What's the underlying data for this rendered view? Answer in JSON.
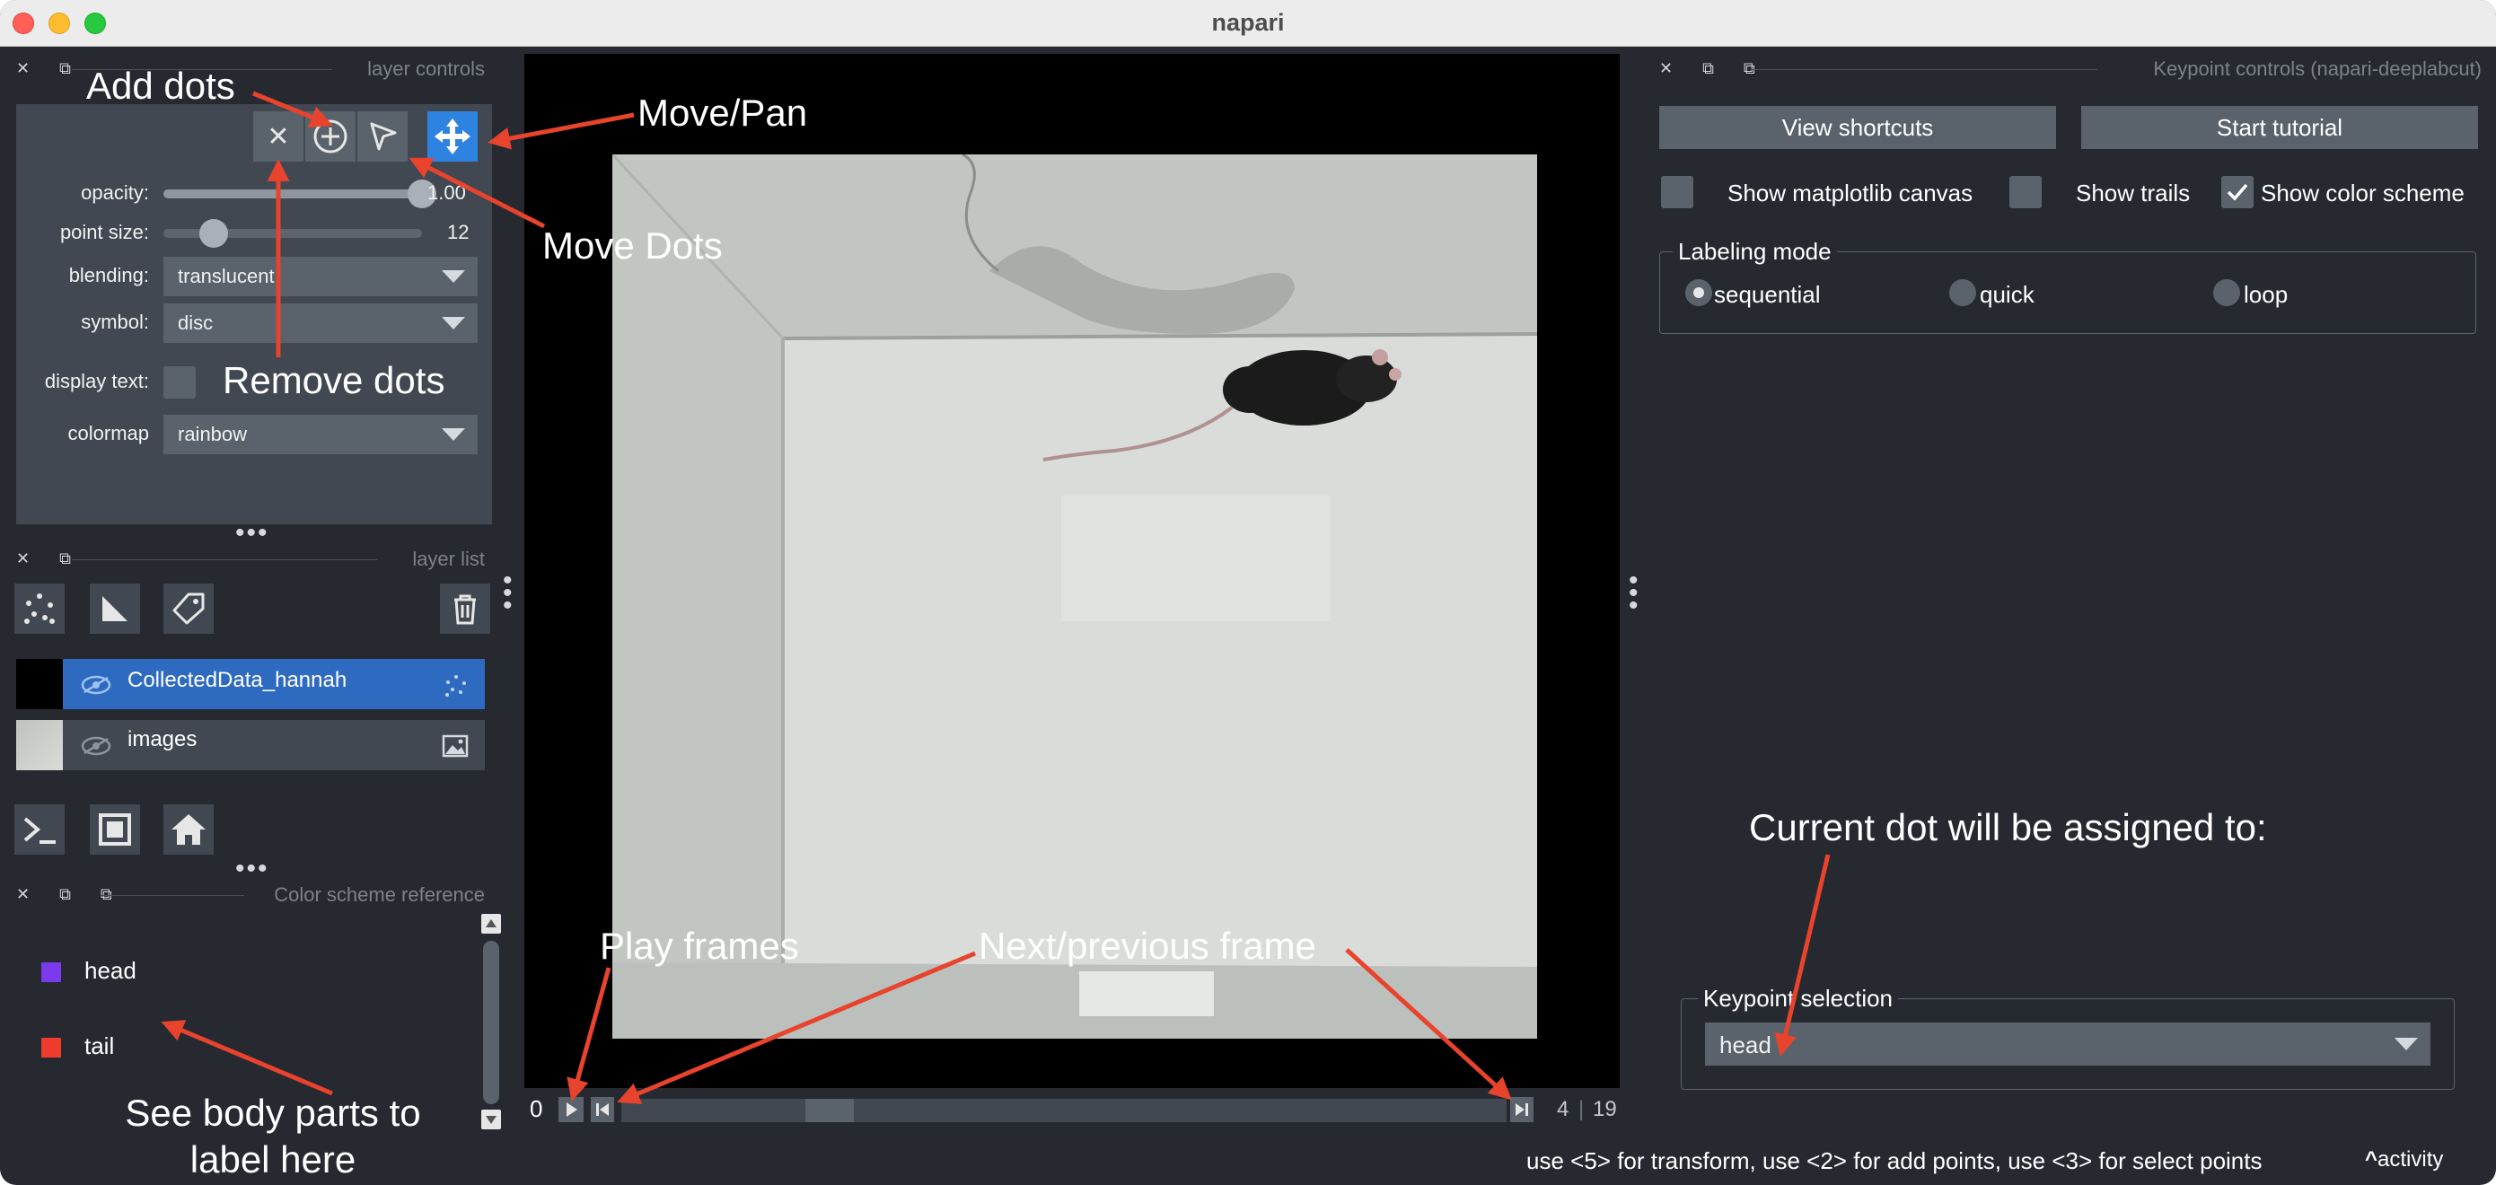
{
  "window": {
    "title": "napari"
  },
  "layer_controls": {
    "panel_title": "layer controls",
    "properties": {
      "opacity_label": "opacity:",
      "opacity_value": "1.00",
      "opacity_fraction": 1.0,
      "point_size_label": "point size:",
      "point_size_value": "12",
      "point_size_fraction": 0.14,
      "blending_label": "blending:",
      "blending_value": "translucent",
      "symbol_label": "symbol:",
      "symbol_value": "disc",
      "display_text_label": "display text:",
      "colormap_label": "colormap",
      "colormap_value": "rainbow"
    }
  },
  "layer_list": {
    "panel_title": "layer list",
    "layers": [
      {
        "name": "CollectedData_hannah",
        "selected": true
      },
      {
        "name": "images",
        "selected": false
      }
    ]
  },
  "color_scheme": {
    "panel_title": "Color scheme reference",
    "items": [
      {
        "label": "head",
        "color": "#7c3aed"
      },
      {
        "label": "tail",
        "color": "#ef3b2c"
      }
    ]
  },
  "viewer": {
    "frame_start": "0",
    "current_frame": "4",
    "frame_total": "19",
    "slider_position": 0.22
  },
  "keypoint_controls": {
    "panel_title": "Keypoint controls (napari-deeplabcut)",
    "view_shortcuts": "View shortcuts",
    "start_tutorial": "Start tutorial",
    "show_matplotlib": "Show matplotlib canvas",
    "show_trails": "Show trails",
    "show_color_scheme": "Show color scheme",
    "show_color_scheme_checked": true,
    "labeling_mode": {
      "title": "Labeling mode",
      "options": [
        "sequential",
        "quick",
        "loop"
      ],
      "selected": "sequential"
    },
    "keypoint_selection": {
      "title": "Keypoint selection",
      "value": "head"
    }
  },
  "status_bar": {
    "message": "use <5> for transform, use <2> for add points, use <3> for select points",
    "activity": "activity"
  },
  "annotations": {
    "add_dots": "Add dots",
    "move_pan": "Move/Pan",
    "move_dots": "Move Dots",
    "remove_dots": "Remove dots",
    "play_frames": "Play frames",
    "next_prev": "Next/previous frame",
    "current_dot_assigned": "Current dot will be assigned to:",
    "see_body_parts_line1": "See body parts to",
    "see_body_parts_line2": "label here"
  },
  "colors": {
    "accent": "#2e82e0",
    "selected_layer": "#2e6bc0",
    "annotation_arrow": "#e8432d",
    "panel_bg": "#262930",
    "control_bg": "#414851"
  }
}
